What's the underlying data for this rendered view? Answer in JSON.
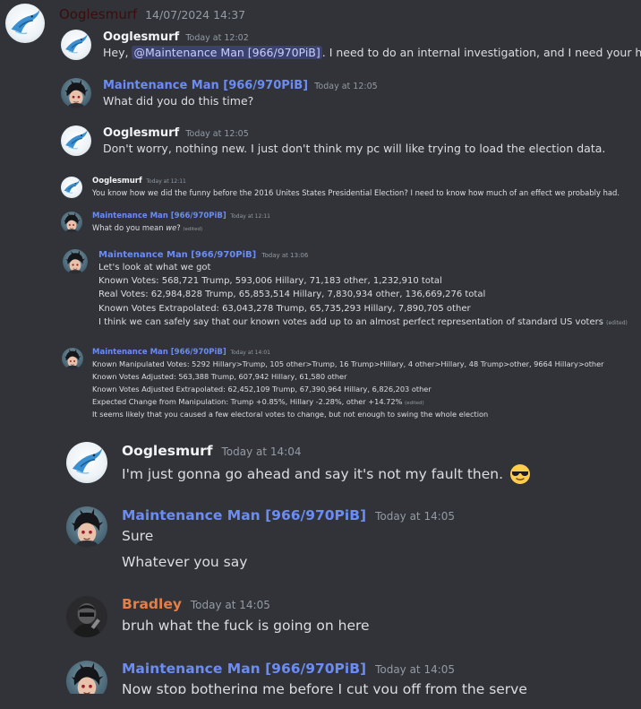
{
  "header": {
    "author": "Ooglesmurf",
    "timestamp": "14/07/2024 14:37"
  },
  "colors": {
    "background": "#313338",
    "ooglesmurf": "#f2f3f5",
    "maintenance": "#6b8cf5",
    "bradley": "#e67e45",
    "mention_bg": "#3c4270"
  },
  "messages": [
    {
      "author": "Ooglesmurf",
      "timestamp": "Today at 12:02",
      "pre": "Hey, ",
      "mention": "@Maintenance Man [966/970PiB]",
      "post": ". I need to do an internal investigation, and I need your help."
    },
    {
      "author": "Maintenance Man [966/970PiB]",
      "timestamp": "Today at 12:05",
      "text": "What did you do this time?"
    },
    {
      "author": "Ooglesmurf",
      "timestamp": "Today at 12:05",
      "text": "Don't worry, nothing new. I just don't think my pc will like trying to load the election data."
    },
    {
      "author": "Ooglesmurf",
      "timestamp": "Today at 12:11",
      "text": "You know how we did the funny before the 2016 Unites States Presidential Election? I need to know how much of an effect we probably had."
    },
    {
      "author": "Maintenance Man [966/970PiB]",
      "timestamp": "Today at 12:11",
      "text": "What do you mean ",
      "emph": "we",
      "tail": "?",
      "edited": "(edited)"
    },
    {
      "author": "Maintenance Man [966/970PiB]",
      "timestamp": "Today at 13:06",
      "lines": [
        "Let's look at what we got",
        "Known Votes: 568,721 Trump, 593,006 Hillary, 71,183 other, 1,232,910 total",
        "Real Votes: 62,984,828 Trump, 65,853,514 Hillary, 7,830,934 other, 136,669,276 total",
        "Known Votes Extrapolated: 63,043,278 Trump, 65,735,293 Hillary, 7,890,705 other",
        "I think we can safely say that our known votes add up to an almost perfect representation of standard US voters"
      ],
      "edited": "(edited)"
    },
    {
      "author": "Maintenance Man [966/970PiB]",
      "timestamp": "Today at 14:01",
      "lines": [
        "Known Manipulated Votes: 5292 Hillary>Trump, 105 other>Trump, 16 Trump>Hillary, 4 other>Hillary, 48 Trump>other, 9664 Hillary>other",
        "Known Votes Adjusted: 563,388 Trump, 607,942 Hillary, 61,580 other",
        "Known Votes Adjusted Extrapolated: 62,452,109 Trump, 67,390,964 Hillary, 6,826,203 other",
        "Expected Change from Manipulation: Trump +0.85%, Hillary -2.28%, other +14.72%",
        "It seems likely that you caused a few electoral votes to change, but not enough to swing the whole election"
      ],
      "edited": "(edited)"
    },
    {
      "author": "Ooglesmurf",
      "timestamp": "Today at 14:04",
      "text": "I'm just gonna go ahead and say it's not my fault then.",
      "emoji": "sunglasses"
    },
    {
      "author": "Maintenance Man [966/970PiB]",
      "timestamp": "Today at 14:05",
      "lines": [
        "Sure",
        "Whatever you say"
      ]
    },
    {
      "author": "Bradley",
      "timestamp": "Today at 14:05",
      "text": "bruh what the fuck is going on here"
    },
    {
      "author": "Maintenance Man [966/970PiB]",
      "timestamp": "Today at 14:05",
      "text": "Now stop bothering me before I cut you off from the serve"
    }
  ]
}
